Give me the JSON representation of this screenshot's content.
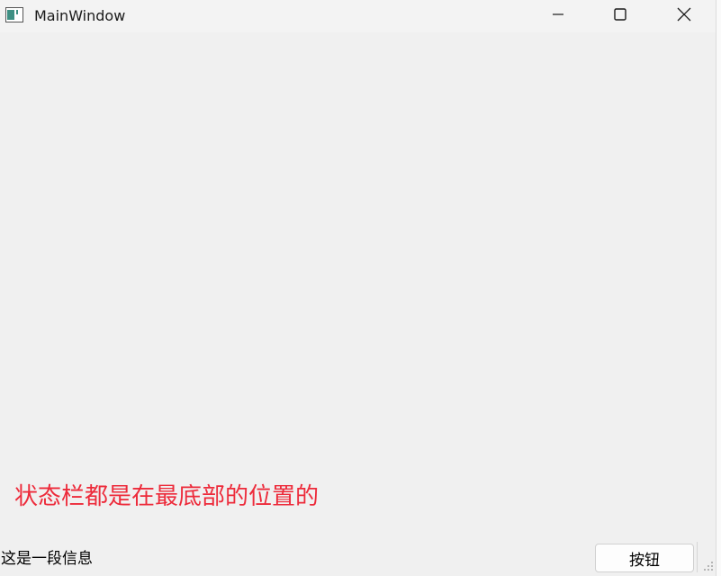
{
  "window": {
    "title": "MainWindow"
  },
  "title_bar": {
    "icons": [
      "app-icon",
      "minimize-icon",
      "maximize-icon",
      "close-icon"
    ]
  },
  "central": {
    "label_text": "状态栏都是在最底部的位置的",
    "label_color": "#ed2a3a"
  },
  "status_bar": {
    "message": "这是一段信息",
    "button_label": "按钮"
  }
}
